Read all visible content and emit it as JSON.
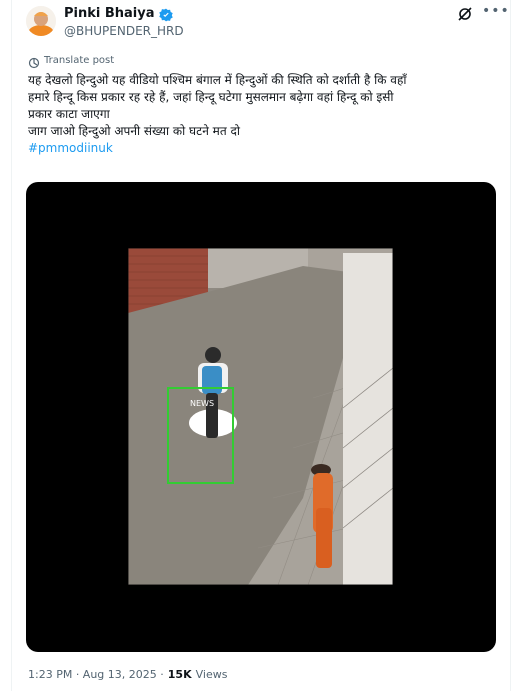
{
  "post": {
    "author": {
      "display_name": "Pinki Bhaiya",
      "handle": "@BHUPENDER_HRD",
      "verified": true
    },
    "translate_label": "Translate post",
    "text_lines": [
      "यह देखलो हिन्दुओ यह वीडियो पश्चिम बंगाल में  हिन्दुओं की स्थिति को दर्शाती है कि वहाँ",
      "हमारे हिन्दू किस प्रकार रह रहे हैं, जहां हिन्दू घटेगा मुसलमान बढ़ेगा वहां हिन्दू को इसी",
      "प्रकार काटा जाएगा",
      "जाग जाओ हिन्दुओ अपनी संख्या को घटने मत दो"
    ],
    "hashtag": "#pmmodiinuk",
    "video_watermark": "NEWS",
    "timestamp": "1:23 PM · Aug 13, 2025 · ",
    "views_count": "15K",
    "views_label": "Views"
  },
  "colors": {
    "link": "#1d9bf0",
    "muted": "#536471",
    "text": "#0f1419"
  }
}
